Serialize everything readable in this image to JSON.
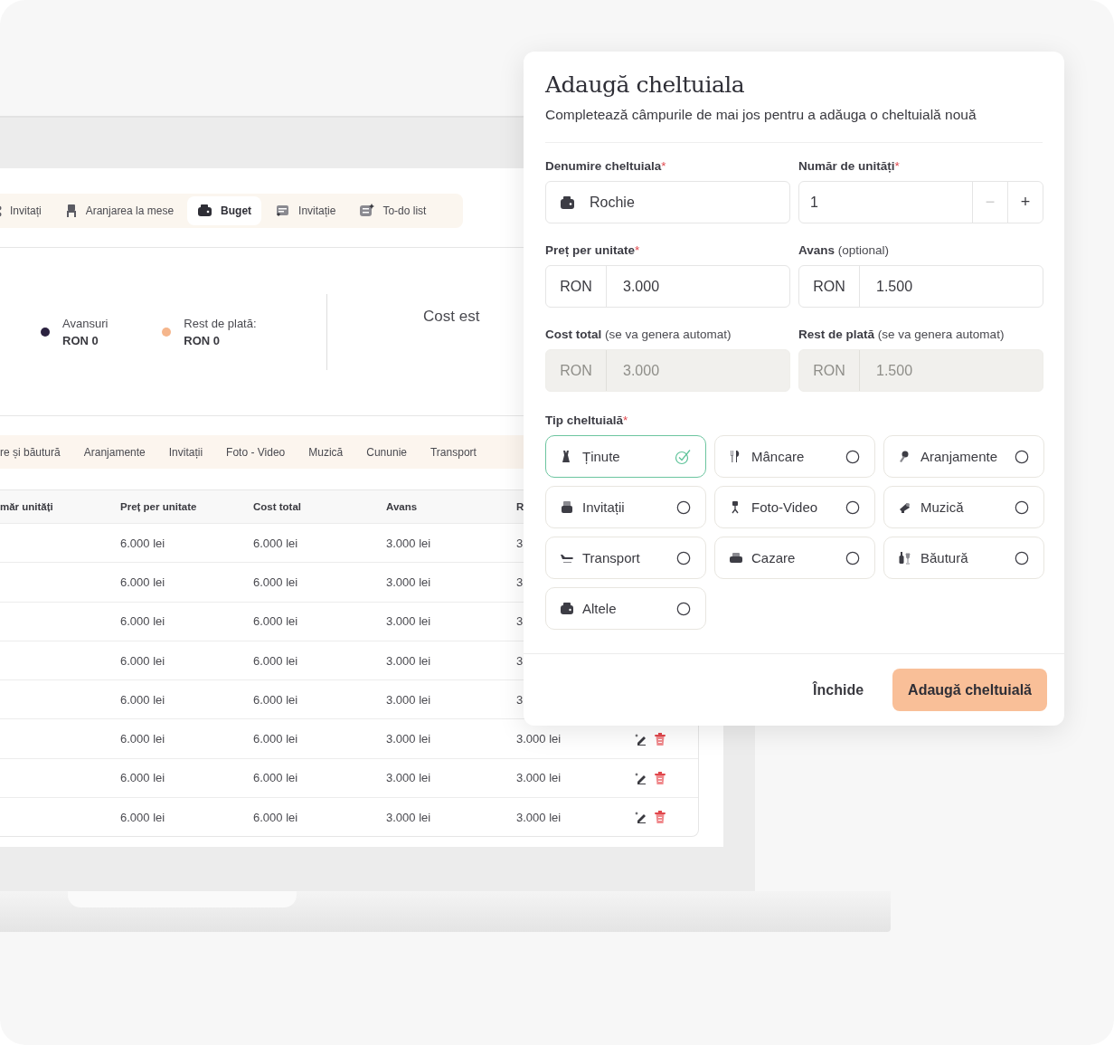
{
  "app": {
    "tabs": [
      {
        "label": "Invitați",
        "selected": false
      },
      {
        "label": "Aranjarea la mese",
        "selected": false
      },
      {
        "label": "Buget",
        "selected": true
      },
      {
        "label": "Invitație",
        "selected": false
      },
      {
        "label": "To-do list",
        "selected": false
      }
    ],
    "summary": {
      "legend": [
        {
          "label": "Avansuri",
          "value": "RON 0",
          "color": "#2b2240"
        },
        {
          "label": "Rest de plată:",
          "value": "RON 0",
          "color": "#f5b68c"
        }
      ],
      "cost_heading": "Cost est"
    },
    "categories": [
      "re și băutură",
      "Aranjamente",
      "Invitații",
      "Foto - Video",
      "Muzică",
      "Cununie",
      "Transport"
    ],
    "table": {
      "columns": [
        "măr unități",
        "Preț per unitate",
        "Cost total",
        "Avans",
        "R"
      ],
      "rows": [
        {
          "unit_price": "6.000 lei",
          "cost_total": "6.000 lei",
          "advance": "3.000 lei",
          "column_5": "3"
        },
        {
          "unit_price": "6.000 lei",
          "cost_total": "6.000 lei",
          "advance": "3.000 lei",
          "column_5": "3"
        },
        {
          "unit_price": "6.000 lei",
          "cost_total": "6.000 lei",
          "advance": "3.000 lei",
          "column_5": "3"
        },
        {
          "unit_price": "6.000 lei",
          "cost_total": "6.000 lei",
          "advance": "3.000 lei",
          "column_5": "3"
        },
        {
          "unit_price": "6.000 lei",
          "cost_total": "6.000 lei",
          "advance": "3.000 lei",
          "column_5": "3"
        },
        {
          "unit_price": "6.000 lei",
          "cost_total": "6.000 lei",
          "advance": "3.000 lei",
          "column_5": "3.000 lei",
          "actions": true
        },
        {
          "unit_price": "6.000 lei",
          "cost_total": "6.000 lei",
          "advance": "3.000 lei",
          "column_5": "3.000 lei",
          "actions": true
        },
        {
          "unit_price": "6.000 lei",
          "cost_total": "6.000 lei",
          "advance": "3.000 lei",
          "column_5": "3.000 lei",
          "actions": true
        }
      ]
    }
  },
  "dialog": {
    "title": "Adaugă cheltuiala",
    "subtitle": "Completează câmpurile de mai jos pentru a adăuga o cheltuială nouă",
    "fields": [
      {
        "kind": "text",
        "label": "Denumire cheltuiala",
        "mark": "*",
        "value": "Rochie"
      },
      {
        "kind": "stepper",
        "label": "Număr de unități",
        "mark": "*",
        "value": "1",
        "minus": "−",
        "plus": "+",
        "minus_disabled": true
      },
      {
        "kind": "currency",
        "label": "Preț per unitate",
        "mark": "*",
        "currency": "RON",
        "value": "3.000",
        "disabled": false
      },
      {
        "kind": "currency",
        "label": "Avans",
        "note": "(optional)",
        "currency": "RON",
        "value": "1.500",
        "disabled": false
      },
      {
        "kind": "currency",
        "label": "Cost total",
        "note": "(se va genera automat)",
        "currency": "RON",
        "value": "3.000",
        "disabled": true
      },
      {
        "kind": "currency",
        "label": "Rest de plată",
        "note": "(se va genera automat)",
        "currency": "RON",
        "value": "1.500",
        "disabled": true
      }
    ],
    "type_label": "Tip cheltuială",
    "type_mark": "*",
    "types": [
      {
        "label": "Ținute",
        "selected": true
      },
      {
        "label": "Mâncare",
        "selected": false
      },
      {
        "label": "Aranjamente",
        "selected": false
      },
      {
        "label": "Invitații",
        "selected": false
      },
      {
        "label": "Foto-Video",
        "selected": false
      },
      {
        "label": "Muzică",
        "selected": false
      },
      {
        "label": "Transport",
        "selected": false
      },
      {
        "label": "Cazare",
        "selected": false
      },
      {
        "label": "Băutură",
        "selected": false
      },
      {
        "label": "Altele",
        "selected": false
      }
    ],
    "buttons": {
      "close": "Închide",
      "submit": "Adaugă cheltuială"
    }
  }
}
